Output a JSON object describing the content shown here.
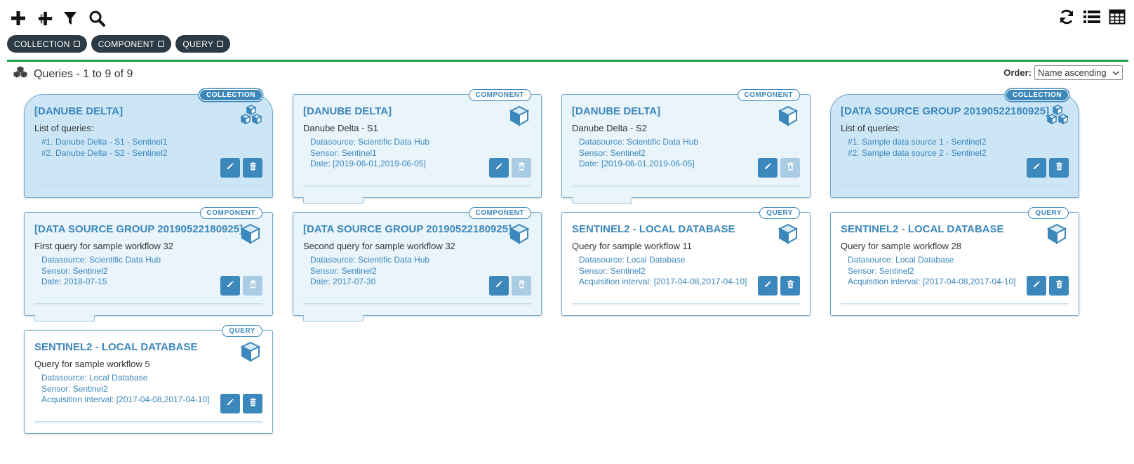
{
  "toolbar": {
    "left_icons": [
      "plus-icon",
      "plus-cross-icon",
      "filter-icon",
      "search-icon"
    ],
    "right_icons": [
      "refresh-icon",
      "list-view-icon",
      "table-view-icon"
    ]
  },
  "tags": [
    {
      "label": "COLLECTION"
    },
    {
      "label": "COMPONENT"
    },
    {
      "label": "QUERY"
    }
  ],
  "list": {
    "title": "Queries - 1 to 9 of 9",
    "order_label": "Order:",
    "order_value": "Name ascending"
  },
  "colors": {
    "accent": "#3c87bb",
    "divider": "#1e9c4a",
    "tag_bg": "#2b3a45",
    "collection_bg": "#cde6f6",
    "component_bg": "#e9f4fb"
  },
  "cards": [
    {
      "type": "collection",
      "badge": "COLLECTION",
      "title": "[DANUBE DELTA]",
      "subtitle": "List of queries:",
      "lines": [
        "#1. Danube Delta - S1 - Sentinel1",
        "#2. Danube Delta - S2 - Sentinel2"
      ],
      "delete_enabled": true
    },
    {
      "type": "component",
      "badge": "COMPONENT",
      "title": "[DANUBE DELTA]",
      "subtitle": "Danube Delta - S1",
      "lines": [
        "Datasource: Scientific Data Hub",
        "Sensor: Sentinel1",
        "Date: [2019-06-01,2019-06-05]"
      ],
      "delete_enabled": false
    },
    {
      "type": "component",
      "badge": "COMPONENT",
      "title": "[DANUBE DELTA]",
      "subtitle": "Danube Delta - S2",
      "lines": [
        "Datasource: Scientific Data Hub",
        "Sensor: Sentinel2",
        "Date: [2019-06-01,2019-06-05]"
      ],
      "delete_enabled": false
    },
    {
      "type": "collection",
      "badge": "COLLECTION",
      "title": "[DATA SOURCE GROUP 20190522180925]",
      "subtitle": "List of queries:",
      "lines": [
        "#1. Sample data source 1 - Sentinel2",
        "#2. Sample data source 2 - Sentinel2"
      ],
      "delete_enabled": true
    },
    {
      "type": "component",
      "badge": "COMPONENT",
      "title": "[DATA SOURCE GROUP 20190522180925]",
      "subtitle": "First query for sample workflow 32",
      "lines": [
        "Datasource: Scientific Data Hub",
        "Sensor: Sentinel2",
        "Date: 2018-07-15"
      ],
      "delete_enabled": false
    },
    {
      "type": "component",
      "badge": "COMPONENT",
      "title": "[DATA SOURCE GROUP 20190522180925]",
      "subtitle": "Second query for sample workflow 32",
      "lines": [
        "Datasource: Scientific Data Hub",
        "Sensor: Sentinel2",
        "Date: 2017-07-30"
      ],
      "delete_enabled": false
    },
    {
      "type": "query",
      "badge": "QUERY",
      "title": "SENTINEL2 - LOCAL DATABASE",
      "subtitle": "Query for sample workflow 11",
      "lines": [
        "Datasource: Local Database",
        "Sensor: Sentinel2",
        "Acquisition interval: [2017-04-08,2017-04-10]"
      ],
      "delete_enabled": true
    },
    {
      "type": "query",
      "badge": "QUERY",
      "title": "SENTINEL2 - LOCAL DATABASE",
      "subtitle": "Query for sample workflow 28",
      "lines": [
        "Datasource: Local Database",
        "Sensor: Sentinel2",
        "Acquisition interval: [2017-04-08,2017-04-10]"
      ],
      "delete_enabled": true
    },
    {
      "type": "query",
      "badge": "QUERY",
      "title": "SENTINEL2 - LOCAL DATABASE",
      "subtitle": "Query for sample workflow 5",
      "lines": [
        "Datasource: Local Database",
        "Sensor: Sentinel2",
        "Acquisition interval: [2017-04-08,2017-04-10]"
      ],
      "delete_enabled": true
    }
  ]
}
